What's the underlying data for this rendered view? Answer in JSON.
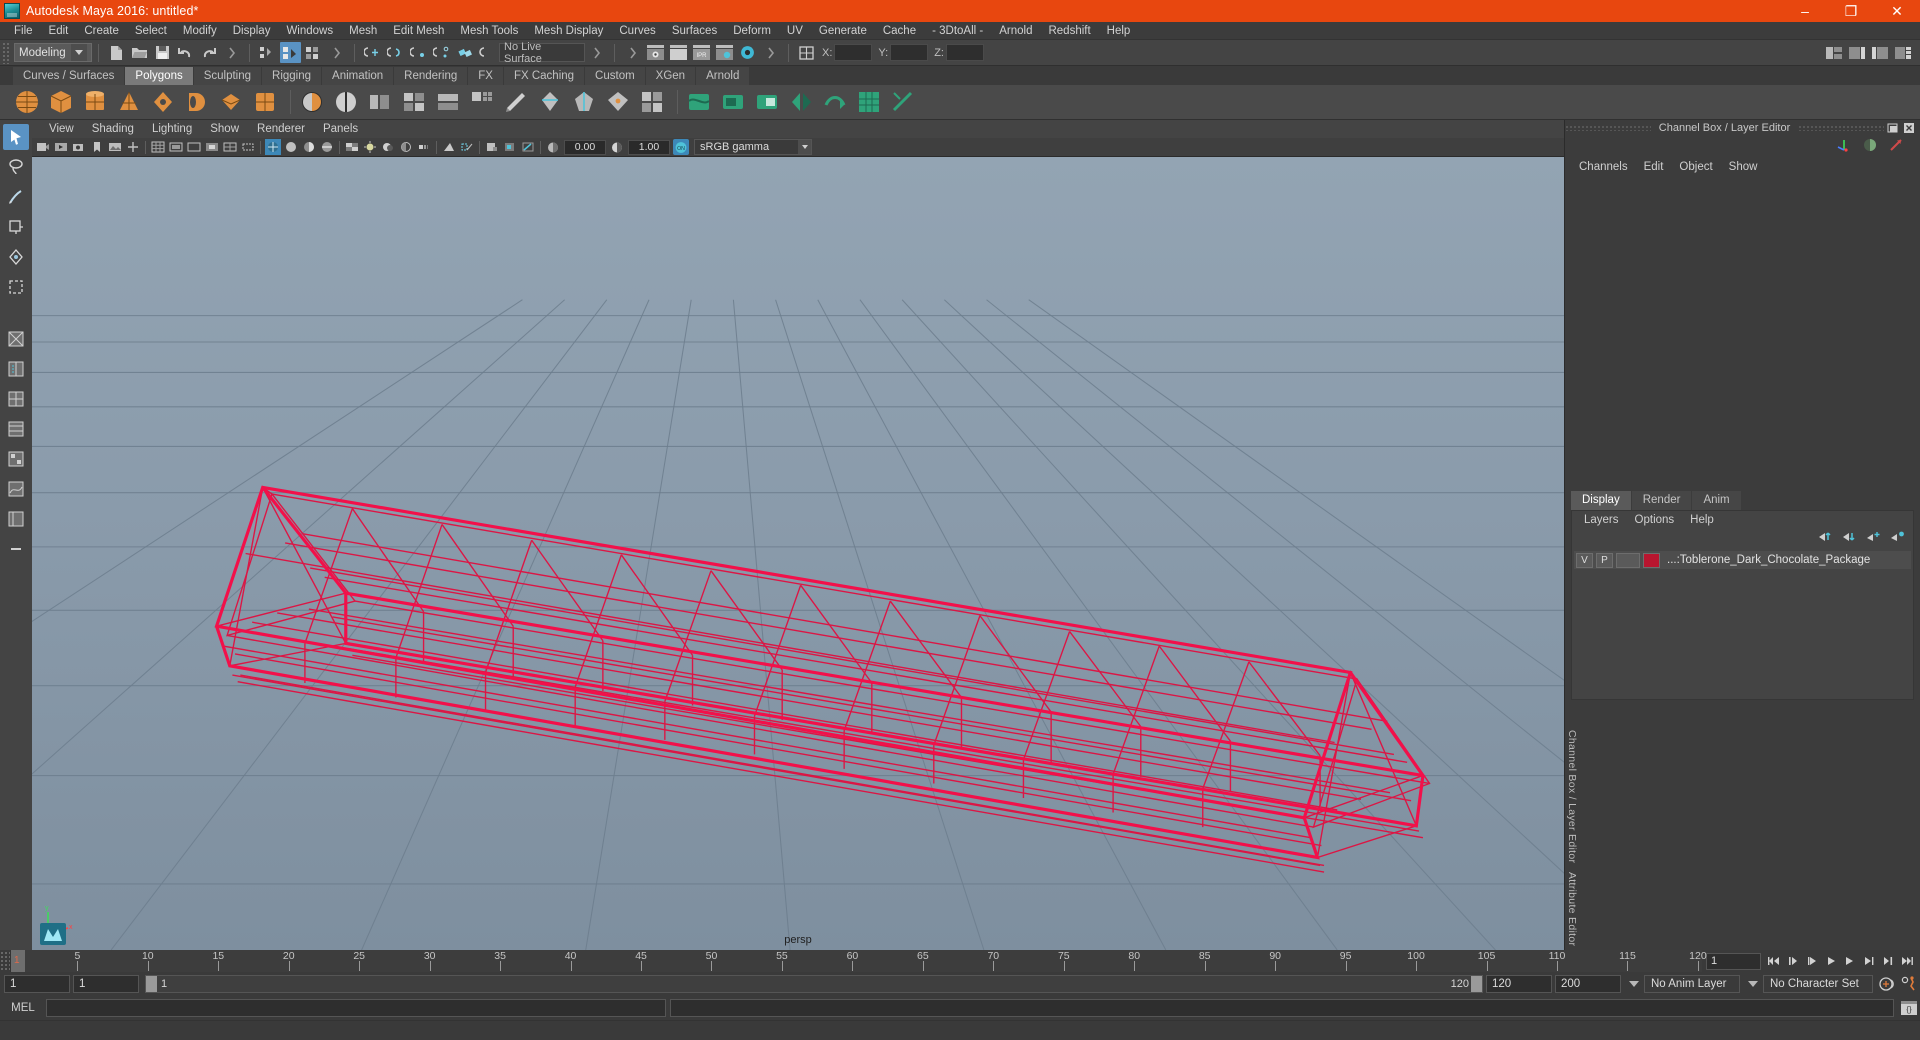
{
  "window": {
    "title": "Autodesk Maya 2016: untitled*",
    "minimize": "–",
    "maximize": "❐",
    "close": "✕",
    "accent_color": "#e8470f"
  },
  "menubar": {
    "items": [
      "File",
      "Edit",
      "Create",
      "Select",
      "Modify",
      "Display",
      "Windows",
      "Mesh",
      "Edit Mesh",
      "Mesh Tools",
      "Mesh Display",
      "Curves",
      "Surfaces",
      "Deform",
      "UV",
      "Generate",
      "Cache",
      "- 3DtoAll -",
      "Arnold",
      "Redshift",
      "Help"
    ]
  },
  "statusline": {
    "menuset": "Modeling",
    "live_surface": "No Live Surface",
    "coord_x_label": "X:",
    "coord_y_label": "Y:",
    "coord_z_label": "Z:",
    "coord_x_value": "",
    "coord_y_value": "",
    "coord_z_value": "",
    "ipr_label": "IPR"
  },
  "shelf": {
    "tabs": [
      "Curves / Surfaces",
      "Polygons",
      "Sculpting",
      "Rigging",
      "Animation",
      "Rendering",
      "FX",
      "FX Caching",
      "Custom",
      "XGen",
      "Arnold"
    ],
    "selected": "Polygons"
  },
  "viewport": {
    "menus": [
      "View",
      "Shading",
      "Lighting",
      "Show",
      "Renderer",
      "Panels"
    ],
    "camera_label": "persp",
    "exposure_value": "0.00",
    "gamma_value": "1.00",
    "color_management": "sRGB gamma",
    "wireframe_color": "#e01040",
    "background_color": "#8b9cac",
    "grid_color": "#6e7f8f"
  },
  "right_panel": {
    "title": "Channel Box / Layer Editor",
    "channel_menus": [
      "Channels",
      "Edit",
      "Object",
      "Show"
    ],
    "side_labels": [
      "Channel Box / Layer Editor",
      "Attribute Editor"
    ],
    "layer_editor": {
      "tabs": [
        "Display",
        "Render",
        "Anim"
      ],
      "selected_tab": "Display",
      "menus": [
        "Layers",
        "Options",
        "Help"
      ],
      "layers": [
        {
          "visibility": "V",
          "playback": "P",
          "color": "#b8152f",
          "name": "...:Toblerone_Dark_Chocolate_Package"
        }
      ]
    }
  },
  "time_slider": {
    "current_frame": "1",
    "ticks": [
      5,
      10,
      15,
      20,
      25,
      30,
      35,
      40,
      45,
      50,
      55,
      60,
      65,
      70,
      75,
      80,
      85,
      90,
      95,
      100,
      105,
      110,
      115,
      120
    ],
    "frame_field": "1",
    "range_start": 1,
    "range_end": 120
  },
  "range_slider": {
    "anim_start": "1",
    "range_start": "1",
    "slider_min_label": "1",
    "slider_max_label": "120",
    "range_end": "120",
    "anim_end": "200",
    "anim_layer": "No Anim Layer",
    "character_set": "No Character Set"
  },
  "command_line": {
    "label": "MEL",
    "input_value": "",
    "output_value": ""
  }
}
